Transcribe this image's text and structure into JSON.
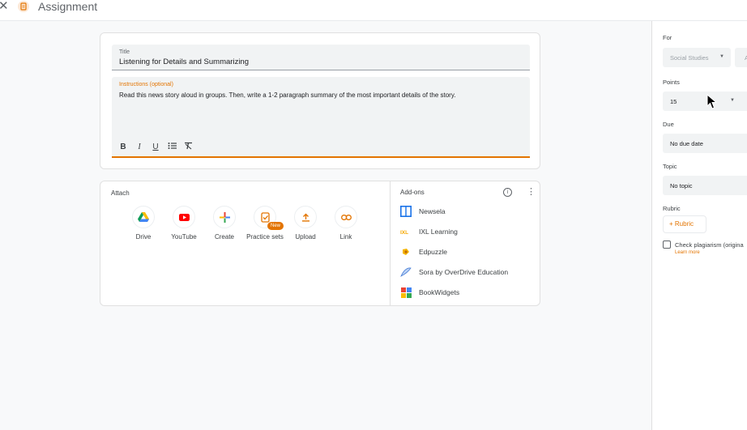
{
  "topbar": {
    "title": "Assignment"
  },
  "form": {
    "title_label": "Title",
    "title_value": "Listening for Details and Summarizing",
    "instructions_label": "Instructions (optional)",
    "instructions_value": "Read this news story aloud in groups. Then, write a 1-2 paragraph summary of the most important details of the story.",
    "format": [
      "B",
      "I",
      "U",
      "list",
      "clear"
    ]
  },
  "attach": {
    "label": "Attach",
    "items": [
      {
        "label": "Drive",
        "icon": "drive-icon"
      },
      {
        "label": "YouTube",
        "icon": "youtube-icon"
      },
      {
        "label": "Create",
        "icon": "plus-icon"
      },
      {
        "label": "Practice sets",
        "icon": "practice-sets-icon",
        "badge": "New"
      },
      {
        "label": "Upload",
        "icon": "upload-icon"
      },
      {
        "label": "Link",
        "icon": "link-icon"
      }
    ]
  },
  "addons": {
    "label": "Add-ons",
    "items": [
      {
        "name": "Newsela",
        "icon": "newsela-icon"
      },
      {
        "name": "IXL Learning",
        "icon": "ixl-icon"
      },
      {
        "name": "Edpuzzle",
        "icon": "edpuzzle-icon"
      },
      {
        "name": "Sora by OverDrive Education",
        "icon": "sora-icon"
      },
      {
        "name": "BookWidgets",
        "icon": "bookwidgets-icon"
      }
    ]
  },
  "side": {
    "for_label": "For",
    "for_value": "Social Studies",
    "points_label": "Points",
    "points_value": "15",
    "due_label": "Due",
    "due_value": "No due date",
    "topic_label": "Topic",
    "topic_value": "No topic",
    "rubric_label": "Rubric",
    "rubric_button": "+ Rubric",
    "plagiarism_label": "Check plagiarism (origina",
    "learn_more": "Learn more"
  },
  "colors": {
    "accent": "#e37400",
    "background": "#f8f9fa"
  }
}
